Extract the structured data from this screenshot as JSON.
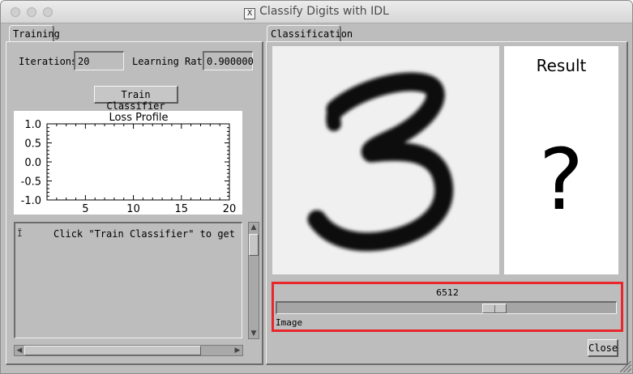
{
  "window": {
    "title": "Classify Digits with IDL"
  },
  "training": {
    "tab_label": "Training",
    "iterations_label": "Iterations",
    "iterations_value": "20",
    "learning_rate_label": "Learning Rate",
    "learning_rate_value": "0.900000",
    "train_button": "Train Classifier",
    "log_text": "Click \"Train Classifier\" to get"
  },
  "classification": {
    "tab_label": "Classification",
    "result_label": "Result",
    "result_value": "?",
    "slider_value": "6512",
    "slider_fraction": 0.6512,
    "slider_label": "Image",
    "close_button": "Close"
  },
  "chart_data": {
    "type": "line",
    "title": "Loss Profile",
    "xlabel": "",
    "ylabel": "",
    "xlim": [
      1,
      20
    ],
    "ylim": [
      -1.0,
      1.0
    ],
    "x_ticks": [
      "5",
      "10",
      "15",
      "20"
    ],
    "y_ticks": [
      "1.0",
      "0.5",
      "0.0",
      "-0.5",
      "-1.0"
    ],
    "series": [],
    "grid": false
  },
  "colors": {
    "highlight": "#e8262b",
    "background": "#bdbdbd"
  },
  "icons": {
    "title": "x11-icon",
    "scroll_up": "triangle-up-icon",
    "scroll_down": "triangle-down-icon",
    "scroll_left": "triangle-left-icon",
    "scroll_right": "triangle-right-icon"
  }
}
